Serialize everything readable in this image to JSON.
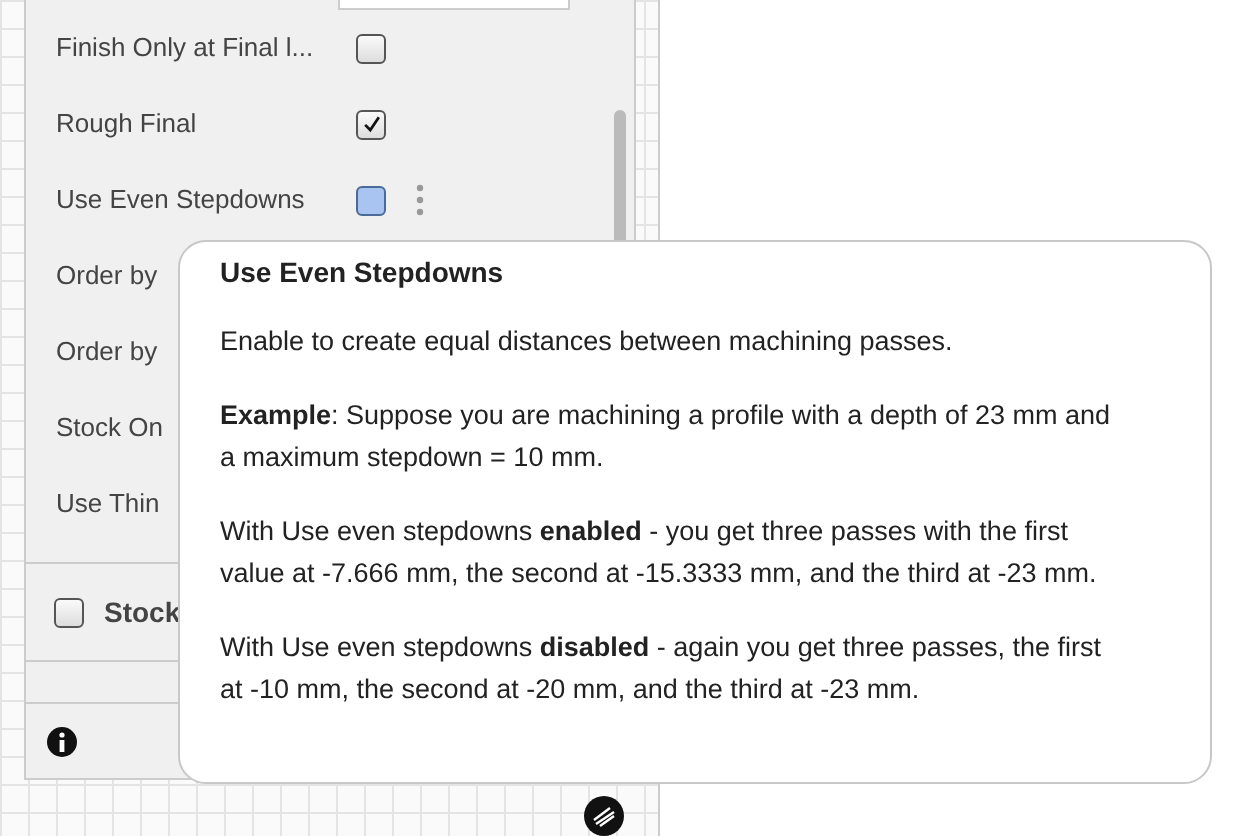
{
  "panel": {
    "rows": [
      {
        "kind": "checkbox",
        "label": "Finish Only at Final l...",
        "checked": false,
        "focused": false
      },
      {
        "kind": "checkbox",
        "label": "Rough Final",
        "checked": true,
        "focused": false
      },
      {
        "kind": "checkbox",
        "label": "Use Even Stepdowns",
        "checked": false,
        "focused": true,
        "menu": true
      },
      {
        "kind": "label",
        "label": "Order by"
      },
      {
        "kind": "label",
        "label": "Order by"
      },
      {
        "kind": "label",
        "label": "Stock On"
      },
      {
        "kind": "label",
        "label": "Use Thin"
      }
    ],
    "section": {
      "label": "Stock",
      "checked": false
    }
  },
  "tooltip": {
    "title": "Use Even Stepdowns",
    "paragraphs": [
      "Enable to create equal distances between machining passes.",
      "**Example**: Suppose you are machining a profile with a depth of 23 mm and a maximum stepdown = 10 mm.",
      "With Use even stepdowns **enabled** - you get three passes with the first value at -7.666 mm, the second at -15.3333 mm, and the third at -23 mm.",
      "With Use even stepdowns **disabled** - again you get three passes, the first at -10 mm, the second at -20 mm, and the third at -23 mm."
    ]
  }
}
